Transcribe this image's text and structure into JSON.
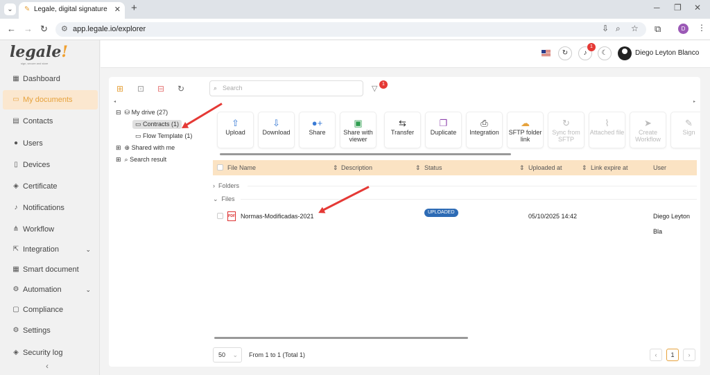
{
  "browser": {
    "tab_title": "Legale, digital signature",
    "url": "app.legale.io/explorer",
    "profile_initial": "D"
  },
  "sidebar": {
    "logo": "legale",
    "logo_tagline": "sign, secure and store",
    "items": [
      {
        "label": "Dashboard",
        "icon": "dashboard-icon"
      },
      {
        "label": "My documents",
        "icon": "folder-icon"
      },
      {
        "label": "Contacts",
        "icon": "contacts-icon"
      },
      {
        "label": "Users",
        "icon": "user-icon"
      },
      {
        "label": "Devices",
        "icon": "device-icon"
      },
      {
        "label": "Certificate",
        "icon": "shield-icon"
      },
      {
        "label": "Notifications",
        "icon": "bell-icon"
      },
      {
        "label": "Workflow",
        "icon": "workflow-icon"
      },
      {
        "label": "Integration",
        "icon": "integration-icon"
      },
      {
        "label": "Smart document",
        "icon": "smart-document-icon"
      },
      {
        "label": "Automation",
        "icon": "automation-icon"
      },
      {
        "label": "Compliance",
        "icon": "compliance-icon"
      },
      {
        "label": "Settings",
        "icon": "gear-icon"
      },
      {
        "label": "Security log",
        "icon": "security-icon"
      }
    ]
  },
  "header": {
    "notification_count": "1",
    "user_name": "Diego Leyton Blanco"
  },
  "toolbar": {
    "search_placeholder": "Search",
    "filter_count": "1"
  },
  "tree": {
    "root": "My drive (27)",
    "contracts": "Contracts (1)",
    "flow_template": "Flow Template (1)",
    "shared": "Shared with me",
    "search_result": "Search result"
  },
  "actions": [
    {
      "label": "Upload",
      "icon": "upload-icon"
    },
    {
      "label": "Download",
      "icon": "download-icon"
    },
    {
      "label": "Share",
      "icon": "share-icon"
    },
    {
      "label": "Share with viewer",
      "icon": "share-viewer-icon"
    },
    {
      "label": "Transfer",
      "icon": "transfer-icon"
    },
    {
      "label": "Duplicate",
      "icon": "duplicate-icon"
    },
    {
      "label": "Integration",
      "icon": "integration-icon"
    },
    {
      "label": "SFTP folder link",
      "icon": "sftp-icon"
    },
    {
      "label": "Sync from SFTP",
      "icon": "sync-icon"
    },
    {
      "label": "Attached file",
      "icon": "paperclip-icon"
    },
    {
      "label": "Create Workflow",
      "icon": "send-icon"
    },
    {
      "label": "Sign",
      "icon": "sign-icon"
    }
  ],
  "table": {
    "columns": [
      "File Name",
      "Description",
      "Status",
      "Uploaded at",
      "Link expire at",
      "User"
    ],
    "folders_label": "Folders",
    "files_label": "Files",
    "rows": [
      {
        "name": "Normas-Modificadas-2021",
        "status": "UPLOADED",
        "uploaded_at": "05/10/2025 14:42",
        "user": "Diego Leyton Bla"
      }
    ]
  },
  "pagination": {
    "page_size": "50",
    "info": "From 1 to 1 (Total 1)",
    "current_page": "1"
  },
  "colors": {
    "accent": "#e6a23c",
    "status": "#2d6bb5",
    "annotation": "#e53935"
  }
}
